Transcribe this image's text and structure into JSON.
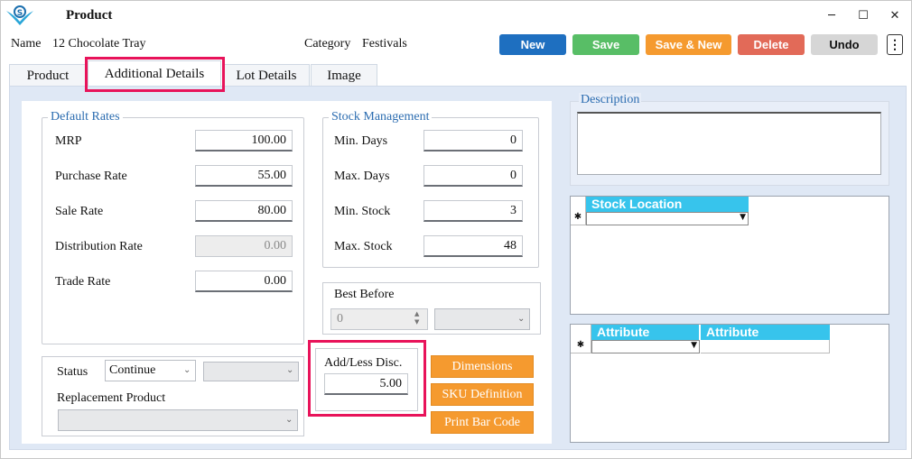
{
  "window": {
    "title": "Product",
    "controls": {
      "minimize": "─",
      "maximize": "☐",
      "close": "✕"
    }
  },
  "header": {
    "name_label": "Name",
    "name_value": "12 Chocolate Tray",
    "category_label": "Category",
    "category_value": "Festivals"
  },
  "toolbar": {
    "new": "New",
    "save": "Save",
    "save_new": "Save & New",
    "delete": "Delete",
    "undo": "Undo",
    "more": "⋮",
    "colors": {
      "new": "#1e6fc0",
      "save": "#58be66",
      "save_new": "#f59a2f",
      "delete": "#e26a58",
      "undo": "#d6d6d6"
    }
  },
  "tabs": [
    {
      "label": "Product"
    },
    {
      "label": "Additional Details"
    },
    {
      "label": "Lot Details"
    },
    {
      "label": "Image"
    }
  ],
  "default_rates": {
    "legend": "Default Rates",
    "mrp": {
      "label": "MRP",
      "value": "100.00"
    },
    "purchase": {
      "label": "Purchase Rate",
      "value": "55.00"
    },
    "sale": {
      "label": "Sale Rate",
      "value": "80.00"
    },
    "distribution": {
      "label": "Distribution Rate",
      "value": "0.00"
    },
    "trade": {
      "label": "Trade Rate",
      "value": "0.00"
    }
  },
  "stock": {
    "legend": "Stock Management",
    "min_days": {
      "label": "Min. Days",
      "value": "0"
    },
    "max_days": {
      "label": "Max. Days",
      "value": "0"
    },
    "min_stock": {
      "label": "Min. Stock",
      "value": "3"
    },
    "max_stock": {
      "label": "Max. Stock",
      "value": "48"
    }
  },
  "best_before": {
    "label": "Best Before",
    "value": "0"
  },
  "status": {
    "label": "Status",
    "value": "Continue",
    "replacement_label": "Replacement Product"
  },
  "disc": {
    "label": "Add/Less Disc.",
    "value": "5.00"
  },
  "actions": {
    "dimensions": "Dimensions",
    "sku": "SKU Definition",
    "barcode": "Print Bar Code"
  },
  "description": {
    "legend": "Description"
  },
  "stock_location": {
    "header": "Stock Location",
    "new_row": "✱"
  },
  "attributes": {
    "header1": "Attribute",
    "header2": "Attribute",
    "new_row": "✱"
  }
}
